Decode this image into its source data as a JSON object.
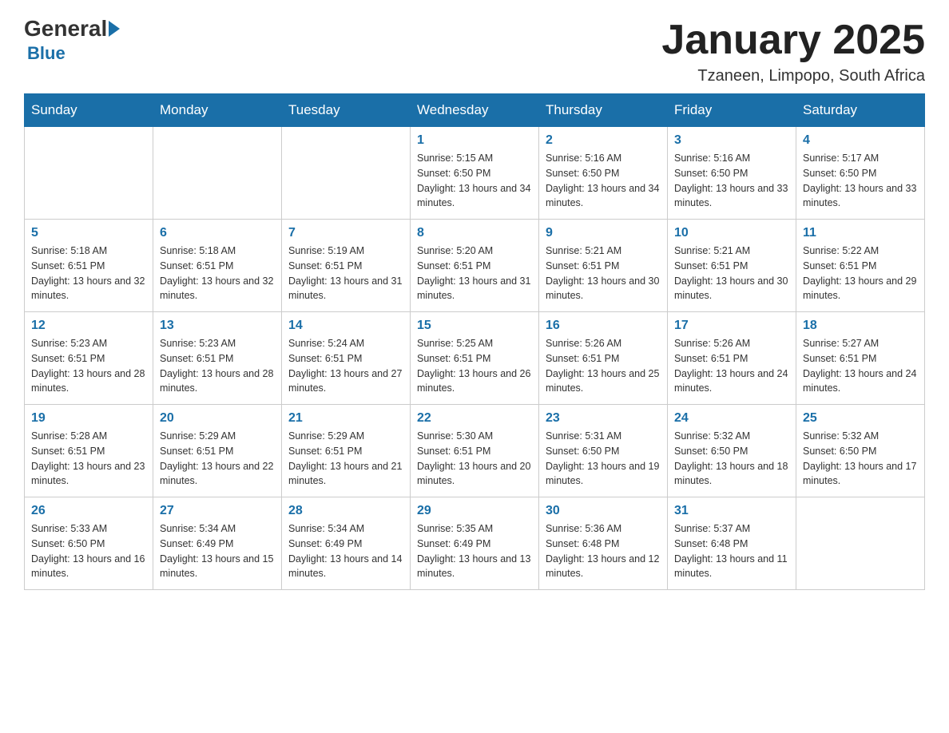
{
  "logo": {
    "general": "General",
    "blue": "Blue"
  },
  "title": "January 2025",
  "location": "Tzaneen, Limpopo, South Africa",
  "days_of_week": [
    "Sunday",
    "Monday",
    "Tuesday",
    "Wednesday",
    "Thursday",
    "Friday",
    "Saturday"
  ],
  "weeks": [
    [
      {
        "day": "",
        "info": ""
      },
      {
        "day": "",
        "info": ""
      },
      {
        "day": "",
        "info": ""
      },
      {
        "day": "1",
        "info": "Sunrise: 5:15 AM\nSunset: 6:50 PM\nDaylight: 13 hours and 34 minutes."
      },
      {
        "day": "2",
        "info": "Sunrise: 5:16 AM\nSunset: 6:50 PM\nDaylight: 13 hours and 34 minutes."
      },
      {
        "day": "3",
        "info": "Sunrise: 5:16 AM\nSunset: 6:50 PM\nDaylight: 13 hours and 33 minutes."
      },
      {
        "day": "4",
        "info": "Sunrise: 5:17 AM\nSunset: 6:50 PM\nDaylight: 13 hours and 33 minutes."
      }
    ],
    [
      {
        "day": "5",
        "info": "Sunrise: 5:18 AM\nSunset: 6:51 PM\nDaylight: 13 hours and 32 minutes."
      },
      {
        "day": "6",
        "info": "Sunrise: 5:18 AM\nSunset: 6:51 PM\nDaylight: 13 hours and 32 minutes."
      },
      {
        "day": "7",
        "info": "Sunrise: 5:19 AM\nSunset: 6:51 PM\nDaylight: 13 hours and 31 minutes."
      },
      {
        "day": "8",
        "info": "Sunrise: 5:20 AM\nSunset: 6:51 PM\nDaylight: 13 hours and 31 minutes."
      },
      {
        "day": "9",
        "info": "Sunrise: 5:21 AM\nSunset: 6:51 PM\nDaylight: 13 hours and 30 minutes."
      },
      {
        "day": "10",
        "info": "Sunrise: 5:21 AM\nSunset: 6:51 PM\nDaylight: 13 hours and 30 minutes."
      },
      {
        "day": "11",
        "info": "Sunrise: 5:22 AM\nSunset: 6:51 PM\nDaylight: 13 hours and 29 minutes."
      }
    ],
    [
      {
        "day": "12",
        "info": "Sunrise: 5:23 AM\nSunset: 6:51 PM\nDaylight: 13 hours and 28 minutes."
      },
      {
        "day": "13",
        "info": "Sunrise: 5:23 AM\nSunset: 6:51 PM\nDaylight: 13 hours and 28 minutes."
      },
      {
        "day": "14",
        "info": "Sunrise: 5:24 AM\nSunset: 6:51 PM\nDaylight: 13 hours and 27 minutes."
      },
      {
        "day": "15",
        "info": "Sunrise: 5:25 AM\nSunset: 6:51 PM\nDaylight: 13 hours and 26 minutes."
      },
      {
        "day": "16",
        "info": "Sunrise: 5:26 AM\nSunset: 6:51 PM\nDaylight: 13 hours and 25 minutes."
      },
      {
        "day": "17",
        "info": "Sunrise: 5:26 AM\nSunset: 6:51 PM\nDaylight: 13 hours and 24 minutes."
      },
      {
        "day": "18",
        "info": "Sunrise: 5:27 AM\nSunset: 6:51 PM\nDaylight: 13 hours and 24 minutes."
      }
    ],
    [
      {
        "day": "19",
        "info": "Sunrise: 5:28 AM\nSunset: 6:51 PM\nDaylight: 13 hours and 23 minutes."
      },
      {
        "day": "20",
        "info": "Sunrise: 5:29 AM\nSunset: 6:51 PM\nDaylight: 13 hours and 22 minutes."
      },
      {
        "day": "21",
        "info": "Sunrise: 5:29 AM\nSunset: 6:51 PM\nDaylight: 13 hours and 21 minutes."
      },
      {
        "day": "22",
        "info": "Sunrise: 5:30 AM\nSunset: 6:51 PM\nDaylight: 13 hours and 20 minutes."
      },
      {
        "day": "23",
        "info": "Sunrise: 5:31 AM\nSunset: 6:50 PM\nDaylight: 13 hours and 19 minutes."
      },
      {
        "day": "24",
        "info": "Sunrise: 5:32 AM\nSunset: 6:50 PM\nDaylight: 13 hours and 18 minutes."
      },
      {
        "day": "25",
        "info": "Sunrise: 5:32 AM\nSunset: 6:50 PM\nDaylight: 13 hours and 17 minutes."
      }
    ],
    [
      {
        "day": "26",
        "info": "Sunrise: 5:33 AM\nSunset: 6:50 PM\nDaylight: 13 hours and 16 minutes."
      },
      {
        "day": "27",
        "info": "Sunrise: 5:34 AM\nSunset: 6:49 PM\nDaylight: 13 hours and 15 minutes."
      },
      {
        "day": "28",
        "info": "Sunrise: 5:34 AM\nSunset: 6:49 PM\nDaylight: 13 hours and 14 minutes."
      },
      {
        "day": "29",
        "info": "Sunrise: 5:35 AM\nSunset: 6:49 PM\nDaylight: 13 hours and 13 minutes."
      },
      {
        "day": "30",
        "info": "Sunrise: 5:36 AM\nSunset: 6:48 PM\nDaylight: 13 hours and 12 minutes."
      },
      {
        "day": "31",
        "info": "Sunrise: 5:37 AM\nSunset: 6:48 PM\nDaylight: 13 hours and 11 minutes."
      },
      {
        "day": "",
        "info": ""
      }
    ]
  ]
}
